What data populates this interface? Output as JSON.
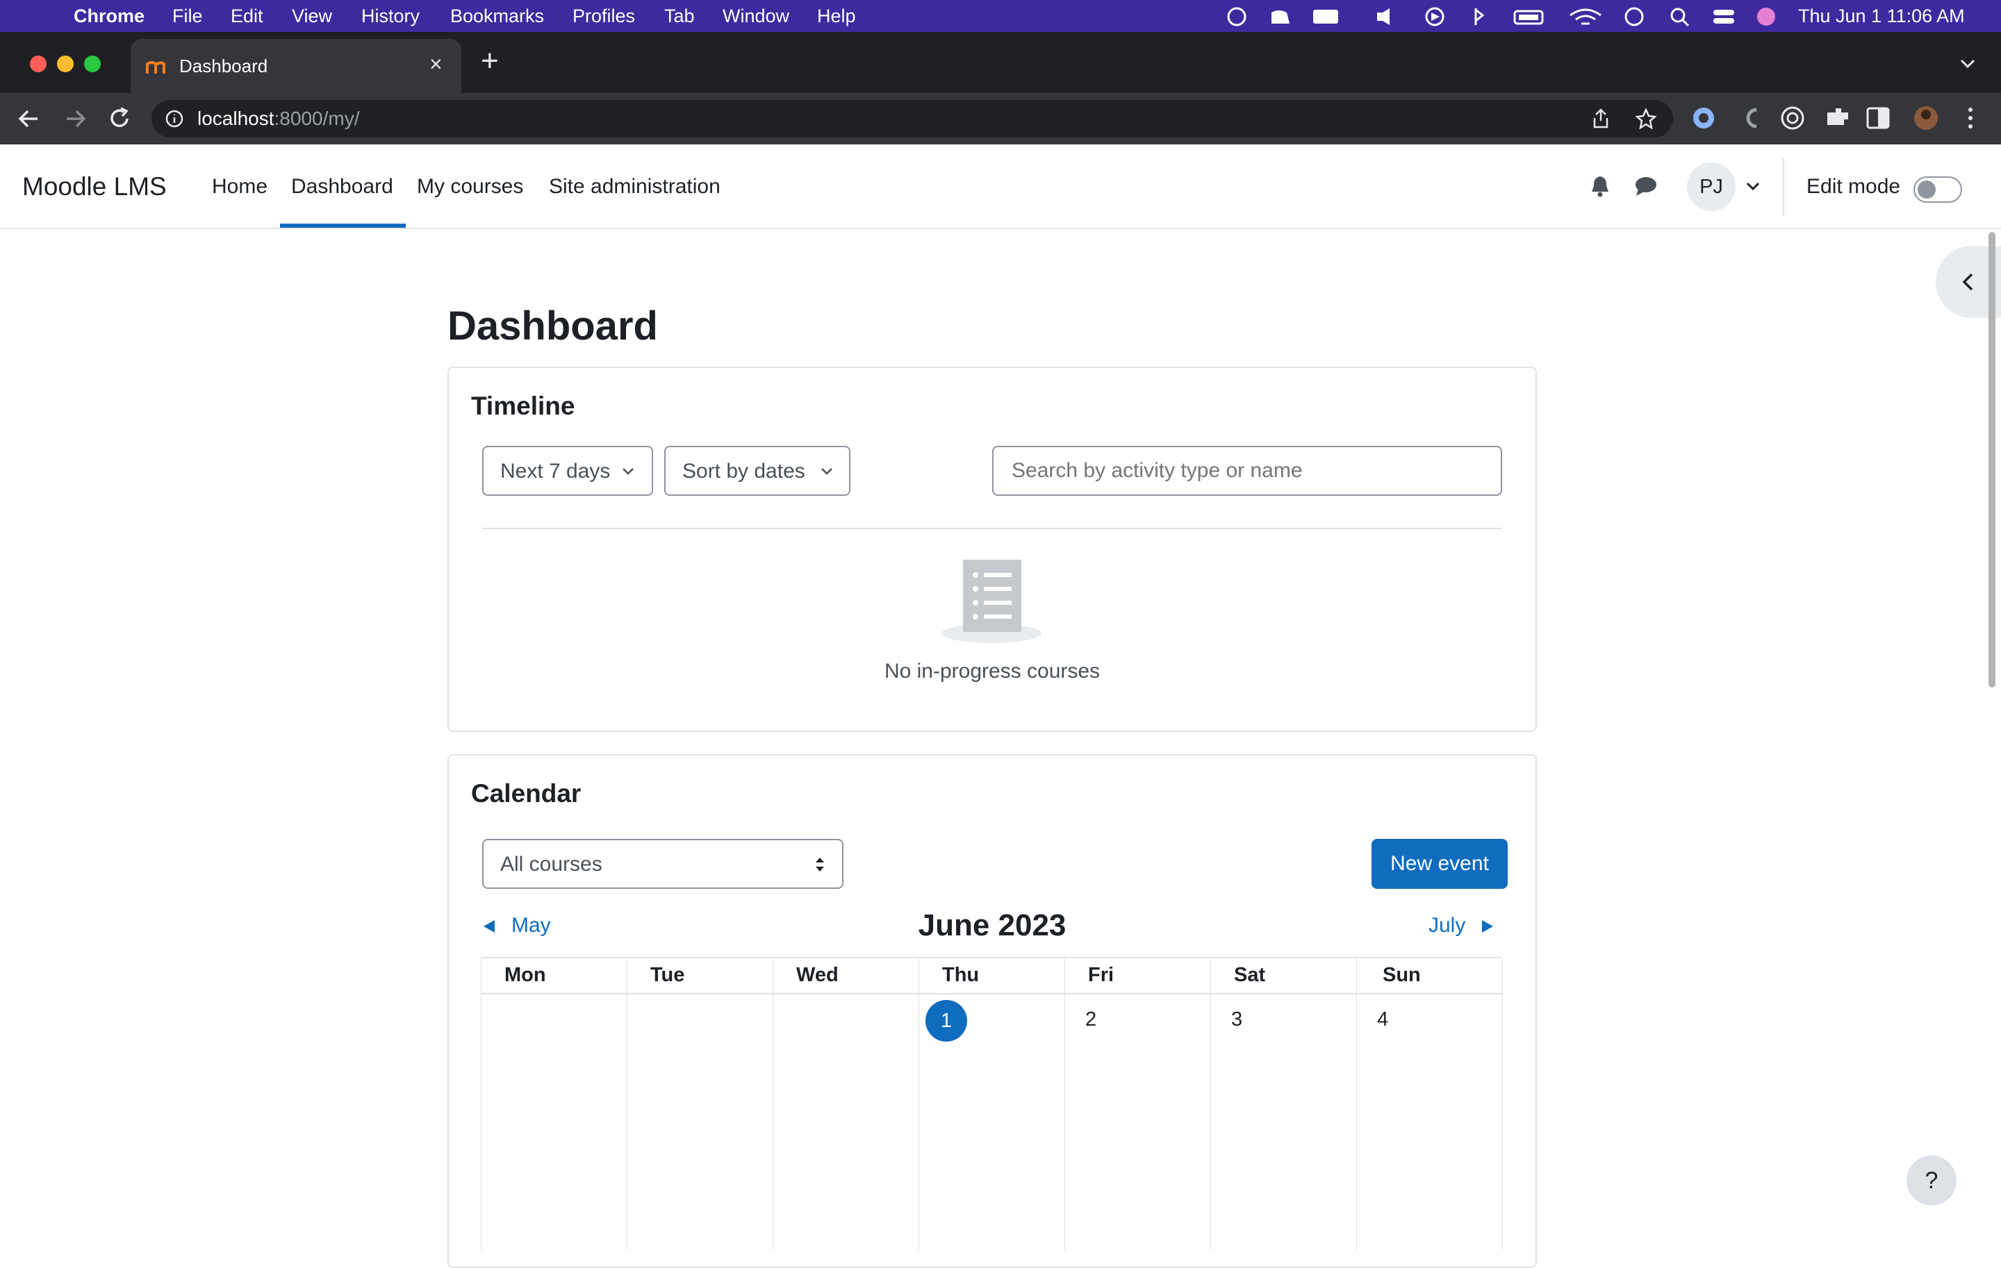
{
  "menubar": {
    "app": "Chrome",
    "items": [
      "File",
      "Edit",
      "View",
      "History",
      "Bookmarks",
      "Profiles",
      "Tab",
      "Window",
      "Help"
    ],
    "datetime": "Thu Jun 1  11:06 AM"
  },
  "browser": {
    "tab_title": "Dashboard",
    "url_host": "localhost",
    "url_path": ":8000/my/"
  },
  "site": {
    "brand": "Moodle LMS",
    "nav": [
      "Home",
      "Dashboard",
      "My courses",
      "Site administration"
    ],
    "active_nav": "Dashboard",
    "user_initials": "PJ",
    "edit_mode_label": "Edit mode",
    "edit_mode_on": false
  },
  "page": {
    "title": "Dashboard"
  },
  "timeline": {
    "title": "Timeline",
    "range_filter": "Next 7 days",
    "sort_filter": "Sort by dates",
    "search_placeholder": "Search by activity type or name",
    "empty_text": "No in-progress courses"
  },
  "calendar": {
    "title": "Calendar",
    "course_select": "All courses",
    "new_event_label": "New event",
    "prev_month": "May",
    "month_title": "June 2023",
    "next_month": "July",
    "weekdays": [
      "Mon",
      "Tue",
      "Wed",
      "Thu",
      "Fri",
      "Sat",
      "Sun"
    ],
    "first_week": [
      "",
      "",
      "",
      "1",
      "2",
      "3",
      "4"
    ],
    "today": "1"
  },
  "help_label": "?",
  "colors": {
    "accent": "#0f6cbf",
    "menubar": "#3e2a9e"
  }
}
